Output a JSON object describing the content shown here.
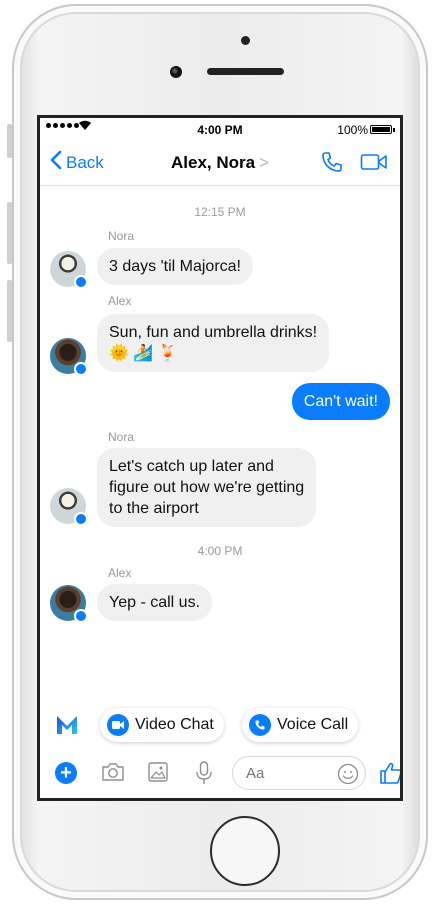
{
  "status_bar": {
    "time": "4:00 PM",
    "battery": "100%"
  },
  "nav": {
    "back_label": "Back",
    "title": "Alex, Nora",
    "title_arrow": ">"
  },
  "messages": {
    "timestamp_1": "12:15 PM",
    "sender_1": "Nora",
    "msg_1": "3 days 'til Majorca!",
    "sender_2": "Alex",
    "msg_2": "Sun, fun and umbrella drinks!\n🌞 🏄 🍹",
    "msg_3": "Can't wait!",
    "sender_3": "Nora",
    "msg_4": "Let's catch up later and\nfigure out how we're getting\nto the airport",
    "timestamp_2": "4:00 PM",
    "sender_4": "Alex",
    "msg_5": "Yep - call us."
  },
  "quick_actions": {
    "video_chat": "Video Chat",
    "voice_call": "Voice Call"
  },
  "composer": {
    "placeholder": "Aa"
  },
  "colors": {
    "accent": "#0a7cff",
    "bubble_gray": "#f0f0f0"
  },
  "icons": [
    "back-chevron-icon",
    "phone-icon",
    "video-camera-icon",
    "messenger-m-icon",
    "plus-icon",
    "camera-icon",
    "image-icon",
    "microphone-icon",
    "emoji-icon",
    "thumbs-up-icon"
  ]
}
